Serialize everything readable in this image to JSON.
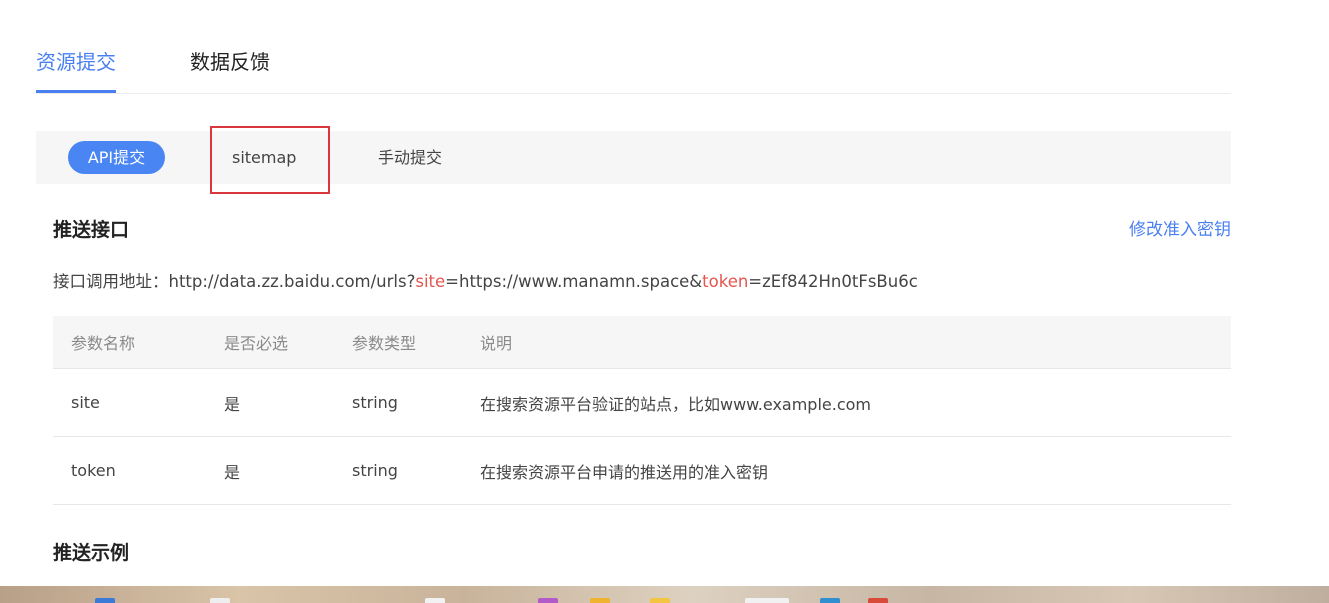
{
  "top_tabs": [
    {
      "label": "资源提交",
      "active": true
    },
    {
      "label": "数据反馈",
      "active": false
    }
  ],
  "sub_tabs": [
    {
      "label": "API提交",
      "active": true
    },
    {
      "label": "sitemap",
      "active": false,
      "highlighted": true
    },
    {
      "label": "手动提交",
      "active": false
    }
  ],
  "push_interface": {
    "title": "推送接口",
    "modify_link": "修改准入密钥",
    "url_label": "接口调用地址：",
    "url_prefix": "http://data.zz.baidu.com/urls?",
    "param_site": "site",
    "site_value": "=https://www.manamn.space&",
    "param_token": "token",
    "token_value": "=zEf842Hn0tFsBu6c"
  },
  "params_table": {
    "headers": [
      "参数名称",
      "是否必选",
      "参数类型",
      "说明"
    ],
    "rows": [
      [
        "site",
        "是",
        "string",
        "在搜索资源平台验证的站点，比如www.example.com"
      ],
      [
        "token",
        "是",
        "string",
        "在搜索资源平台申请的推送用的准入密钥"
      ]
    ]
  },
  "push_example": {
    "title": "推送示例"
  },
  "colors": {
    "accent": "#4a7ff2",
    "highlight": "#d9363e",
    "param_red": "#e4554f"
  }
}
